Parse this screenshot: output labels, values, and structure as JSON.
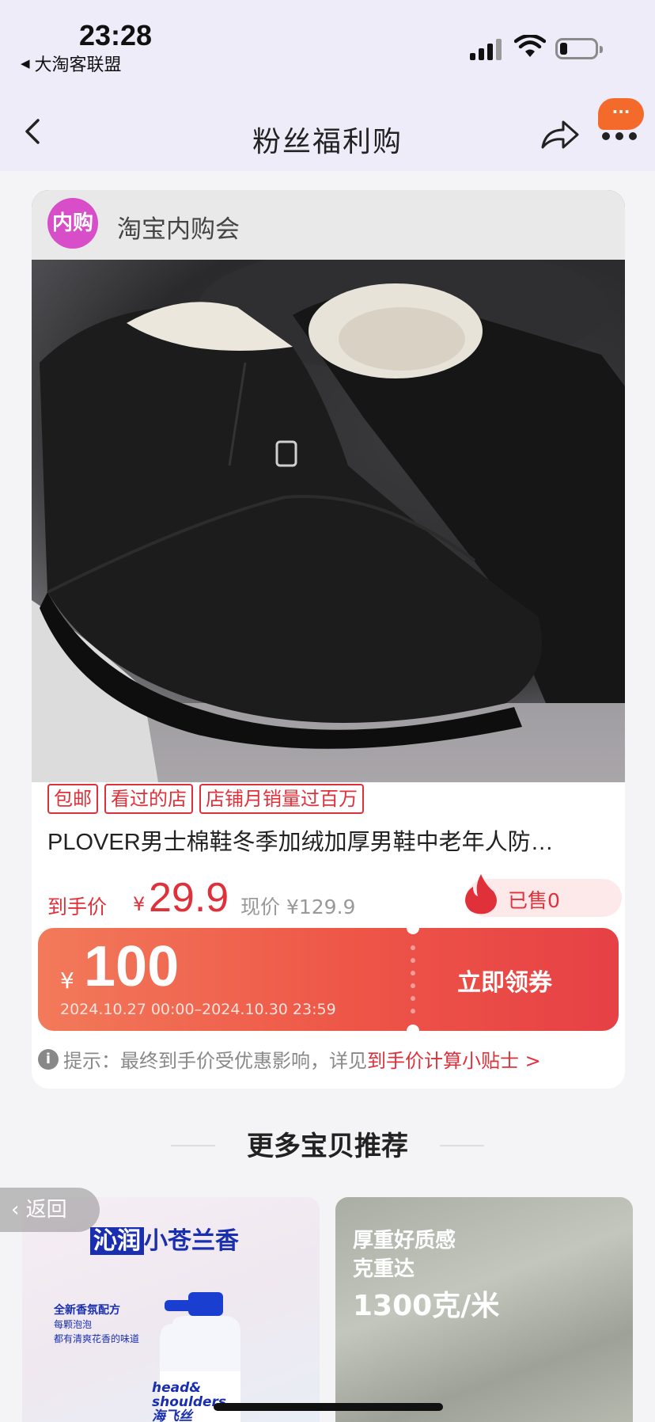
{
  "status_bar": {
    "time": "23:28",
    "back_app": "大淘客联盟"
  },
  "nav": {
    "title": "粉丝福利购",
    "badge": "···"
  },
  "product": {
    "shop_badge": "内购",
    "shop_name": "淘宝内购会",
    "tags": [
      "包邮",
      "看过的店",
      "店铺月销量过百万"
    ],
    "title": "PLOVER男士棉鞋冬季加绒加厚男鞋中老年人防…",
    "price_label": "到手价",
    "currency": "¥",
    "price": "29.9",
    "original_price": "现价 ¥129.9",
    "sold": "已售0"
  },
  "coupon": {
    "currency": "¥",
    "amount": "100",
    "period": "2024.10.27 00:00–2024.10.30 23:59",
    "button": "立即领券"
  },
  "tip": {
    "text": "提示：最终到手价受优惠影响，详见",
    "link": "到手价计算小贴士 >"
  },
  "more": {
    "title": "更多宝贝推荐"
  },
  "recommend": [
    {
      "headline_a": "沁润",
      "headline_b": "小苍兰香",
      "sub1": "全新香氛配方",
      "sub2": "每颗泡泡",
      "sub3": "都有清爽花香的味道",
      "brand_line1": "head&",
      "brand_line2": "shoulders",
      "brand_cn": "海飞丝"
    },
    {
      "line1": "厚重好质感",
      "line2": "克重达",
      "line3": "1300克/米"
    }
  ],
  "back_pill": "返回",
  "colors": {
    "accent_red": "#e0313b",
    "header_bg": "#efecfa",
    "coupon_start": "#f27a5a",
    "coupon_end": "#e64146"
  }
}
